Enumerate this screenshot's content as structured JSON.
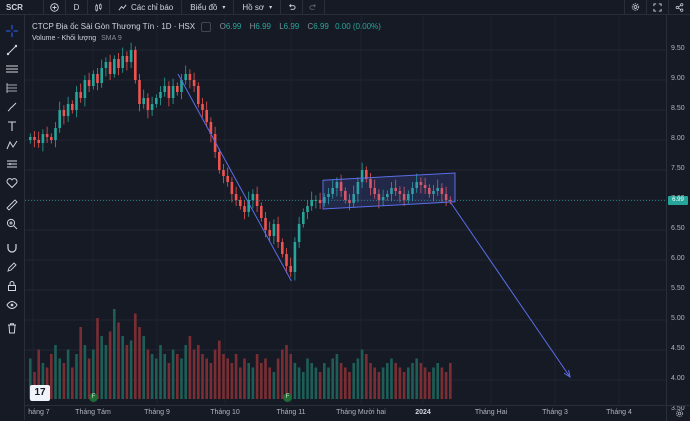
{
  "toolbar": {
    "symbol": "SCR",
    "interval": "D",
    "indicators_label": "Các chỉ báo",
    "layout_label": "Biểu đồ",
    "profile_label": "Hồ sơ"
  },
  "legend": {
    "title": "CTCP Địa ốc Sài Gòn Thương Tín · 1D · HSX",
    "open_label": "O",
    "open": "6.99",
    "high_label": "H",
    "high": "6.99",
    "low_label": "L",
    "low": "6.99",
    "close_label": "C",
    "close": "6.99",
    "change": "0.00 (0.00%)",
    "volume_label": "Volume - Khối lượng",
    "volume_sma": "SMA 9"
  },
  "price_scale": {
    "labels": [
      "9.50",
      "9.00",
      "8.50",
      "8.00",
      "7.50",
      "7.00",
      "6.50",
      "6.00",
      "5.50",
      "5.00",
      "4.50",
      "4.00",
      "3.50"
    ],
    "last_price": "6.99",
    "volume_tag": "0"
  },
  "time_scale": {
    "labels": [
      "háng 7",
      "Tháng Tám",
      "Tháng 9",
      "Tháng 10",
      "Tháng 11",
      "Tháng Mười hai",
      "2024",
      "Tháng Hai",
      "Tháng 3",
      "Tháng 4"
    ]
  },
  "event_badge": "F",
  "logo_text": "17",
  "colors": {
    "up": "#26a69a",
    "down": "#ef5350",
    "line": "#5b6ee8",
    "bg": "#161a25"
  },
  "chart_data": {
    "type": "candlestick",
    "ylim": [
      3.5,
      9.6
    ],
    "trend_lines": [
      {
        "from": [
          9.1,
          "Tháng 9"
        ],
        "to": [
          5.65,
          "Tháng 11"
        ]
      },
      {
        "from": [
          6.95,
          "2024"
        ],
        "to": [
          4.05,
          "Tháng 3"
        ]
      }
    ],
    "channel": {
      "upper": [
        7.33,
        7.45
      ],
      "lower": [
        6.85,
        6.97
      ]
    },
    "candles_close": [
      8.05,
      8.0,
      7.95,
      8.1,
      8.05,
      8.0,
      8.2,
      8.5,
      8.4,
      8.6,
      8.5,
      8.8,
      8.7,
      9.0,
      8.9,
      9.1,
      8.95,
      9.2,
      9.3,
      9.1,
      9.35,
      9.2,
      9.4,
      9.3,
      9.5,
      9.0,
      8.6,
      8.7,
      8.5,
      8.6,
      8.7,
      8.8,
      8.9,
      8.7,
      8.9,
      8.8,
      9.0,
      9.1,
      9.0,
      8.9,
      8.6,
      8.5,
      8.3,
      8.1,
      7.8,
      7.5,
      7.4,
      7.3,
      7.1,
      7.0,
      6.9,
      6.8,
      7.0,
      7.1,
      6.9,
      6.7,
      6.5,
      6.4,
      6.6,
      6.3,
      6.1,
      5.9,
      5.8,
      6.3,
      6.6,
      6.8,
      6.9,
      7.0,
      7.0,
      6.95,
      7.05,
      7.1,
      7.2,
      7.3,
      7.15,
      7.0,
      6.95,
      7.1,
      7.3,
      7.5,
      7.35,
      7.2,
      7.1,
      7.0,
      7.05,
      7.1,
      7.2,
      7.15,
      7.1,
      7.0,
      7.1,
      7.2,
      7.3,
      7.25,
      7.2,
      7.1,
      7.15,
      7.2,
      7.1,
      7.0,
      6.99
    ],
    "volume": [
      0.45,
      0.3,
      0.55,
      0.4,
      0.35,
      0.5,
      0.6,
      0.45,
      0.4,
      0.55,
      0.35,
      0.5,
      0.8,
      0.6,
      0.45,
      0.55,
      0.9,
      0.7,
      0.6,
      0.75,
      1.0,
      0.85,
      0.7,
      0.6,
      0.65,
      0.95,
      0.8,
      0.7,
      0.55,
      0.5,
      0.45,
      0.6,
      0.5,
      0.4,
      0.55,
      0.5,
      0.45,
      0.6,
      0.7,
      0.55,
      0.6,
      0.5,
      0.45,
      0.4,
      0.55,
      0.65,
      0.5,
      0.45,
      0.4,
      0.5,
      0.35,
      0.45,
      0.4,
      0.35,
      0.5,
      0.4,
      0.45,
      0.35,
      0.3,
      0.45,
      0.55,
      0.6,
      0.5,
      0.4,
      0.35,
      0.3,
      0.45,
      0.4,
      0.35,
      0.3,
      0.4,
      0.35,
      0.45,
      0.5,
      0.4,
      0.35,
      0.3,
      0.4,
      0.45,
      0.55,
      0.5,
      0.4,
      0.35,
      0.3,
      0.35,
      0.4,
      0.45,
      0.4,
      0.35,
      0.3,
      0.35,
      0.4,
      0.45,
      0.4,
      0.35,
      0.3,
      0.35,
      0.4,
      0.35,
      0.3,
      0.4
    ]
  }
}
